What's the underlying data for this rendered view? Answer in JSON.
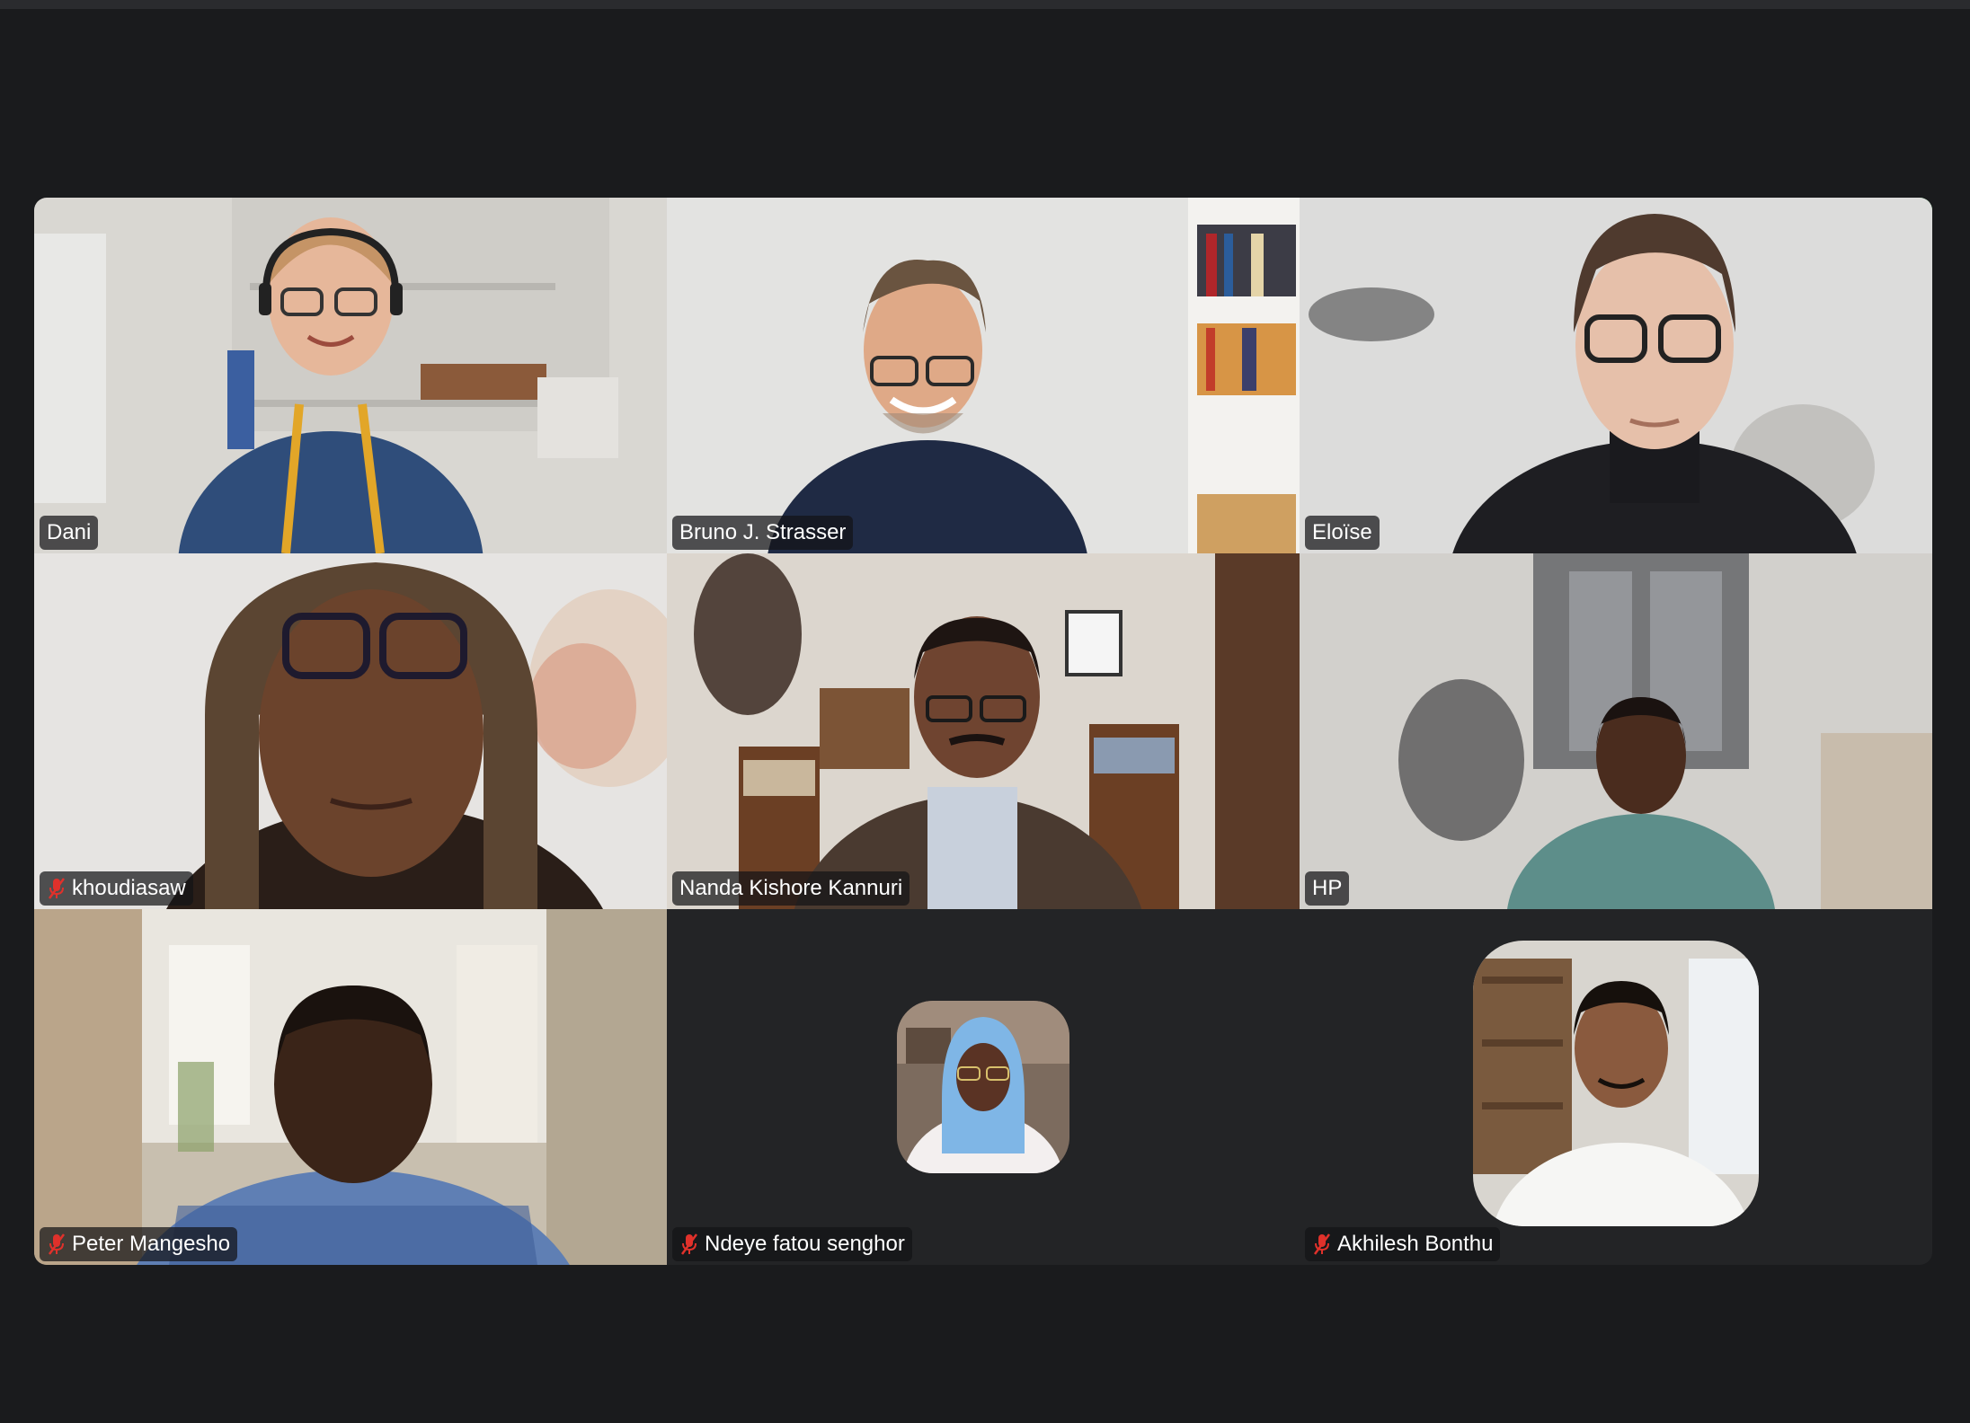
{
  "meeting": {
    "participants": [
      {
        "name": "Dani",
        "muted": false,
        "active_speaker": false
      },
      {
        "name": "Bruno J. Strasser",
        "muted": false,
        "active_speaker": false
      },
      {
        "name": "Eloïse",
        "muted": false,
        "active_speaker": true
      },
      {
        "name": "khoudiasaw",
        "muted": true,
        "active_speaker": false
      },
      {
        "name": "Nanda Kishore Kannuri",
        "muted": false,
        "active_speaker": false
      },
      {
        "name": "HP",
        "muted": false,
        "active_speaker": false
      },
      {
        "name": "Peter Mangesho",
        "muted": true,
        "active_speaker": false
      },
      {
        "name": "Ndeye fatou senghor",
        "muted": true,
        "active_speaker": false
      },
      {
        "name": "Akhilesh Bonthu",
        "muted": true,
        "active_speaker": false
      }
    ]
  },
  "colors": {
    "background": "#1a1b1d",
    "tile_empty": "#232426",
    "active_border": "#31c93b",
    "muted_icon": "#e0312b",
    "name_text": "#ffffff"
  },
  "icons": {
    "muted": "mic-muted-icon"
  }
}
